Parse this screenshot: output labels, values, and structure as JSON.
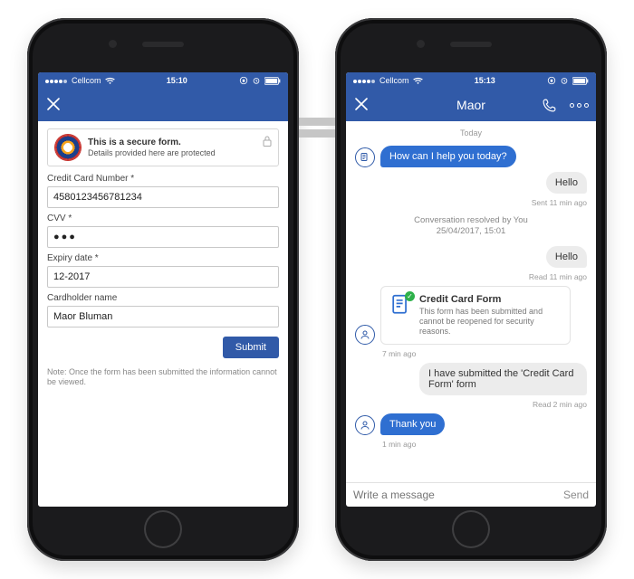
{
  "phone1": {
    "status": {
      "carrier": "Cellcom",
      "time": "15:10"
    },
    "secure": {
      "title": "This is a secure form.",
      "subtitle": "Details provided here are protected"
    },
    "fields": {
      "cc_label": "Credit Card Number *",
      "cc_value": "4580123456781234",
      "cvv_label": "CVV *",
      "cvv_display": "●●●",
      "exp_label": "Expiry date *",
      "exp_value": "12-2017",
      "name_label": "Cardholder name",
      "name_value": "Maor Bluman"
    },
    "submit_label": "Submit",
    "note": "Note: Once the form has been submitted the information cannot be viewed."
  },
  "phone2": {
    "status": {
      "carrier": "Cellcom",
      "time": "15:13"
    },
    "nav": {
      "title": "Maor"
    },
    "day": "Today",
    "agent_msg1": "How can I help you today?",
    "user_msg1": "Hello",
    "user_msg1_meta": "Sent  11 min ago",
    "system_line": "Conversation resolved by You\n25/04/2017, 15:01",
    "user_msg2": "Hello",
    "user_msg2_meta": "Read  11 min ago",
    "card": {
      "title": "Credit Card Form",
      "body": "This form has been submitted and cannot be reopened for security reasons."
    },
    "card_meta": "7 min ago",
    "user_msg3": "I have submitted the 'Credit Card Form' form",
    "user_msg3_meta": "Read  2 min ago",
    "agent_msg2": "Thank you",
    "agent_msg2_meta": "1 min ago",
    "composer": {
      "placeholder": "Write a message",
      "send": "Send"
    }
  }
}
